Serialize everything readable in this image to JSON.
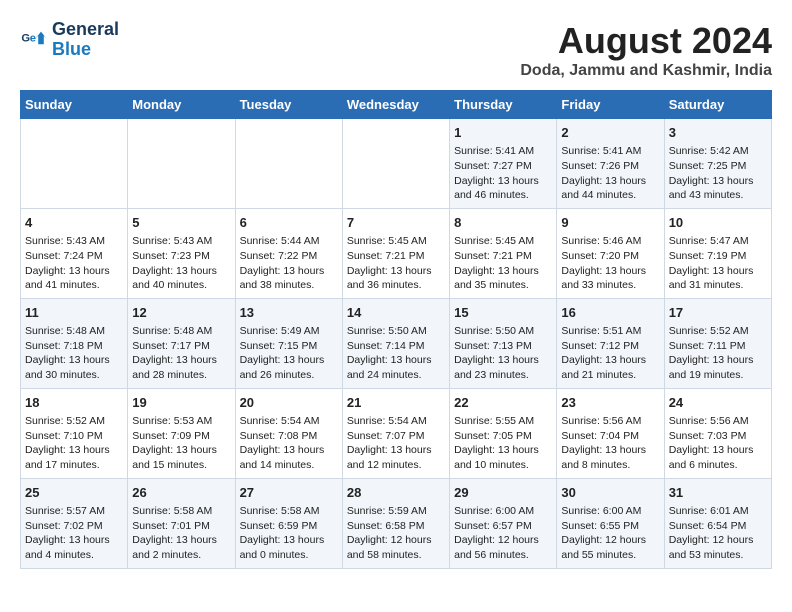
{
  "logo": {
    "line1": "General",
    "line2": "Blue"
  },
  "title": "August 2024",
  "subtitle": "Doda, Jammu and Kashmir, India",
  "days_of_week": [
    "Sunday",
    "Monday",
    "Tuesday",
    "Wednesday",
    "Thursday",
    "Friday",
    "Saturday"
  ],
  "weeks": [
    [
      {
        "num": "",
        "info": ""
      },
      {
        "num": "",
        "info": ""
      },
      {
        "num": "",
        "info": ""
      },
      {
        "num": "",
        "info": ""
      },
      {
        "num": "1",
        "info": "Sunrise: 5:41 AM\nSunset: 7:27 PM\nDaylight: 13 hours\nand 46 minutes."
      },
      {
        "num": "2",
        "info": "Sunrise: 5:41 AM\nSunset: 7:26 PM\nDaylight: 13 hours\nand 44 minutes."
      },
      {
        "num": "3",
        "info": "Sunrise: 5:42 AM\nSunset: 7:25 PM\nDaylight: 13 hours\nand 43 minutes."
      }
    ],
    [
      {
        "num": "4",
        "info": "Sunrise: 5:43 AM\nSunset: 7:24 PM\nDaylight: 13 hours\nand 41 minutes."
      },
      {
        "num": "5",
        "info": "Sunrise: 5:43 AM\nSunset: 7:23 PM\nDaylight: 13 hours\nand 40 minutes."
      },
      {
        "num": "6",
        "info": "Sunrise: 5:44 AM\nSunset: 7:22 PM\nDaylight: 13 hours\nand 38 minutes."
      },
      {
        "num": "7",
        "info": "Sunrise: 5:45 AM\nSunset: 7:21 PM\nDaylight: 13 hours\nand 36 minutes."
      },
      {
        "num": "8",
        "info": "Sunrise: 5:45 AM\nSunset: 7:21 PM\nDaylight: 13 hours\nand 35 minutes."
      },
      {
        "num": "9",
        "info": "Sunrise: 5:46 AM\nSunset: 7:20 PM\nDaylight: 13 hours\nand 33 minutes."
      },
      {
        "num": "10",
        "info": "Sunrise: 5:47 AM\nSunset: 7:19 PM\nDaylight: 13 hours\nand 31 minutes."
      }
    ],
    [
      {
        "num": "11",
        "info": "Sunrise: 5:48 AM\nSunset: 7:18 PM\nDaylight: 13 hours\nand 30 minutes."
      },
      {
        "num": "12",
        "info": "Sunrise: 5:48 AM\nSunset: 7:17 PM\nDaylight: 13 hours\nand 28 minutes."
      },
      {
        "num": "13",
        "info": "Sunrise: 5:49 AM\nSunset: 7:15 PM\nDaylight: 13 hours\nand 26 minutes."
      },
      {
        "num": "14",
        "info": "Sunrise: 5:50 AM\nSunset: 7:14 PM\nDaylight: 13 hours\nand 24 minutes."
      },
      {
        "num": "15",
        "info": "Sunrise: 5:50 AM\nSunset: 7:13 PM\nDaylight: 13 hours\nand 23 minutes."
      },
      {
        "num": "16",
        "info": "Sunrise: 5:51 AM\nSunset: 7:12 PM\nDaylight: 13 hours\nand 21 minutes."
      },
      {
        "num": "17",
        "info": "Sunrise: 5:52 AM\nSunset: 7:11 PM\nDaylight: 13 hours\nand 19 minutes."
      }
    ],
    [
      {
        "num": "18",
        "info": "Sunrise: 5:52 AM\nSunset: 7:10 PM\nDaylight: 13 hours\nand 17 minutes."
      },
      {
        "num": "19",
        "info": "Sunrise: 5:53 AM\nSunset: 7:09 PM\nDaylight: 13 hours\nand 15 minutes."
      },
      {
        "num": "20",
        "info": "Sunrise: 5:54 AM\nSunset: 7:08 PM\nDaylight: 13 hours\nand 14 minutes."
      },
      {
        "num": "21",
        "info": "Sunrise: 5:54 AM\nSunset: 7:07 PM\nDaylight: 13 hours\nand 12 minutes."
      },
      {
        "num": "22",
        "info": "Sunrise: 5:55 AM\nSunset: 7:05 PM\nDaylight: 13 hours\nand 10 minutes."
      },
      {
        "num": "23",
        "info": "Sunrise: 5:56 AM\nSunset: 7:04 PM\nDaylight: 13 hours\nand 8 minutes."
      },
      {
        "num": "24",
        "info": "Sunrise: 5:56 AM\nSunset: 7:03 PM\nDaylight: 13 hours\nand 6 minutes."
      }
    ],
    [
      {
        "num": "25",
        "info": "Sunrise: 5:57 AM\nSunset: 7:02 PM\nDaylight: 13 hours\nand 4 minutes."
      },
      {
        "num": "26",
        "info": "Sunrise: 5:58 AM\nSunset: 7:01 PM\nDaylight: 13 hours\nand 2 minutes."
      },
      {
        "num": "27",
        "info": "Sunrise: 5:58 AM\nSunset: 6:59 PM\nDaylight: 13 hours\nand 0 minutes."
      },
      {
        "num": "28",
        "info": "Sunrise: 5:59 AM\nSunset: 6:58 PM\nDaylight: 12 hours\nand 58 minutes."
      },
      {
        "num": "29",
        "info": "Sunrise: 6:00 AM\nSunset: 6:57 PM\nDaylight: 12 hours\nand 56 minutes."
      },
      {
        "num": "30",
        "info": "Sunrise: 6:00 AM\nSunset: 6:55 PM\nDaylight: 12 hours\nand 55 minutes."
      },
      {
        "num": "31",
        "info": "Sunrise: 6:01 AM\nSunset: 6:54 PM\nDaylight: 12 hours\nand 53 minutes."
      }
    ]
  ]
}
